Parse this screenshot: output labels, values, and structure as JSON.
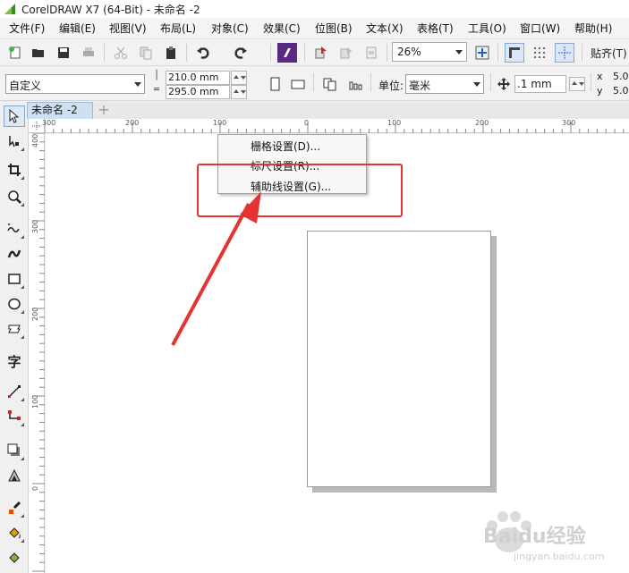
{
  "window": {
    "title": "CorelDRAW X7 (64-Bit) - 未命名 -2"
  },
  "menubar": {
    "items": [
      {
        "label": "文件(F)"
      },
      {
        "label": "编辑(E)"
      },
      {
        "label": "视图(V)"
      },
      {
        "label": "布局(L)"
      },
      {
        "label": "对象(C)"
      },
      {
        "label": "效果(C)"
      },
      {
        "label": "位图(B)"
      },
      {
        "label": "文本(X)"
      },
      {
        "label": "表格(T)"
      },
      {
        "label": "工具(O)"
      },
      {
        "label": "窗口(W)"
      },
      {
        "label": "帮助(H)"
      }
    ]
  },
  "toolbar": {
    "zoom_value": "26%",
    "snap_label": "贴齐(T)"
  },
  "property_bar": {
    "page_preset": "自定义",
    "width_value": "210.0 mm",
    "height_value": "295.0 mm",
    "unit_label": "单位:",
    "unit_value": "毫米",
    "nudge_value": ".1 mm",
    "dup_x_label": "x",
    "dup_x_value": "5.0",
    "dup_y_label": "y",
    "dup_y_value": "5.0"
  },
  "document": {
    "tab_label": "未命名 -2"
  },
  "rulers": {
    "horizontal_ticks": [
      "300",
      "200",
      "100",
      "0",
      "100",
      "200",
      "300"
    ],
    "vertical_ticks": [
      "400",
      "300",
      "200",
      "100",
      "0"
    ]
  },
  "context_menu": {
    "items": [
      {
        "label": "栅格设置(D)..."
      },
      {
        "label": "标尺设置(R)..."
      },
      {
        "label": "辅助线设置(G)..."
      }
    ]
  },
  "colors": {
    "highlight": "#e53333",
    "arrow": "#e53333"
  },
  "watermark": {
    "text": "Baidu经验",
    "url": "jingyan.baidu.com"
  }
}
